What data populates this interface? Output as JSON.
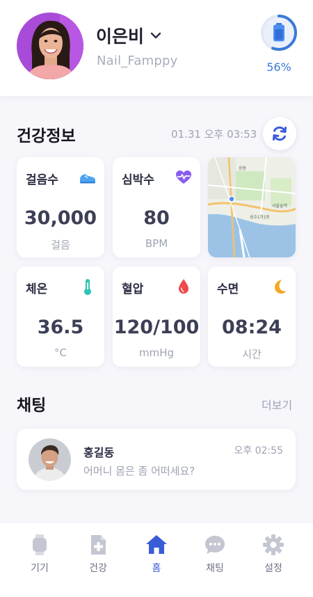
{
  "profile": {
    "name": "이은비",
    "username": "Nail_Famppy",
    "battery_percent_label": "56%",
    "battery_level": 0.56
  },
  "health": {
    "title": "건강정보",
    "updated": "01.31 오후 03:53",
    "cards": [
      {
        "label": "걸음수",
        "value": "30,000",
        "unit": "걸음",
        "icon": "shoe-icon"
      },
      {
        "label": "심박수",
        "value": "80",
        "unit": "BPM",
        "icon": "heartbeat-icon"
      },
      {
        "label": "체온",
        "value": "36.5",
        "unit": "°C",
        "icon": "thermometer-icon"
      },
      {
        "label": "혈압",
        "value": "120/100",
        "unit": "mmHg",
        "icon": "blood-drop-icon"
      },
      {
        "label": "수면",
        "value": "08:24",
        "unit": "시간",
        "icon": "moon-icon"
      }
    ],
    "map_labels": [
      "응봉",
      "서울숲역",
      "성수1가1동"
    ]
  },
  "chat": {
    "title": "채팅",
    "more_label": "더보기",
    "items": [
      {
        "name": "홍길동",
        "time": "오후 02:55",
        "message": "어머니 몸은 좀 어떠세요?"
      }
    ]
  },
  "nav": [
    {
      "label": "기기",
      "icon": "watch-icon",
      "active": false
    },
    {
      "label": "건강",
      "icon": "medical-icon",
      "active": false
    },
    {
      "label": "홈",
      "icon": "home-icon",
      "active": true
    },
    {
      "label": "채팅",
      "icon": "chat-bubble-icon",
      "active": false
    },
    {
      "label": "설정",
      "icon": "gear-icon",
      "active": false
    }
  ],
  "colors": {
    "accent": "#3a5cd8",
    "battery": "#3a7bd5",
    "heart": "#8a5cf0",
    "thermo": "#2bc4b6",
    "blood": "#ef4b4b",
    "moon": "#f5a623"
  }
}
